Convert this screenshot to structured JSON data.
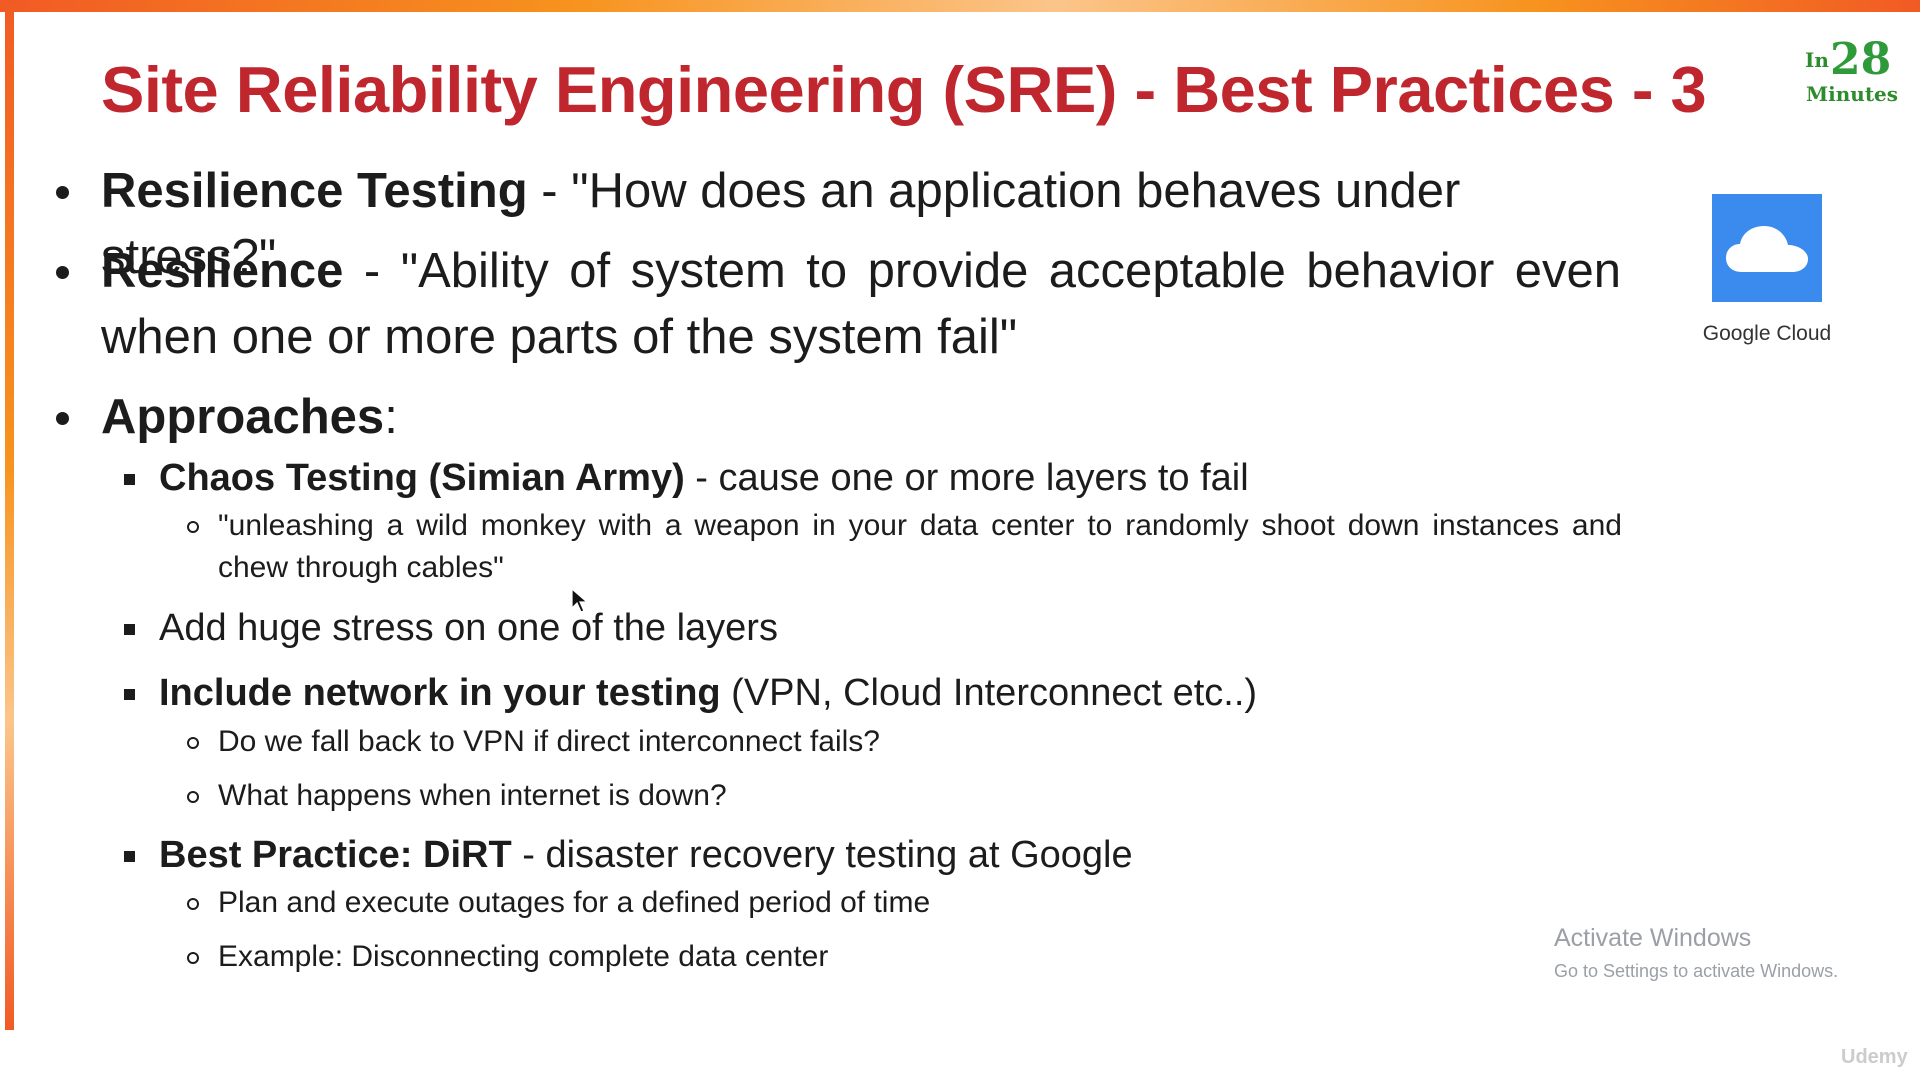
{
  "slide": {
    "title": "Site Reliability Engineering (SRE) - Best Practices - 3"
  },
  "logo": {
    "in": "In",
    "number": "28",
    "minutes": "Minutes"
  },
  "google_cloud": {
    "label": "Google Cloud",
    "tile_color": "#3b8bef"
  },
  "bullets": {
    "b1": {
      "bold": "Resilience Testing",
      "text": " - \"How does an application behaves under stress?\""
    },
    "b2": {
      "bold": "Resilience",
      "text": " - \"Ability of system to provide acceptable behavior even when one or more parts of the system fail\""
    },
    "b3": {
      "bold": "Approaches",
      "text": ":"
    },
    "chaos": {
      "bold": "Chaos Testing (Simian Army)",
      "text": " - cause one or more layers to fail"
    },
    "chaos_sub": {
      "text": "\"unleashing a wild monkey with a weapon in your data center to randomly shoot down instances and chew through cables\""
    },
    "stress": {
      "text": "Add huge stress on one of the layers"
    },
    "network": {
      "bold": "Include network in your testing",
      "text": " (VPN, Cloud Interconnect etc..)"
    },
    "network_sub1": {
      "text": "Do we fall back to VPN if direct interconnect fails?"
    },
    "network_sub2": {
      "text": "What happens when internet is down?"
    },
    "dirt": {
      "bold": "Best Practice: DiRT",
      "text": " - disaster recovery testing at Google"
    },
    "dirt_sub1": {
      "text": "Plan and execute outages for a defined period of time"
    },
    "dirt_sub2": {
      "text": "Example: Disconnecting complete data center"
    }
  },
  "overlay": {
    "activate_title": "Activate Windows",
    "activate_sub": "Go to Settings to activate Windows.",
    "watermark": "Udemy"
  },
  "colors": {
    "title": "#c0262d",
    "accent_orange": "#f7931e",
    "logo_green": "#2e8b2e"
  }
}
